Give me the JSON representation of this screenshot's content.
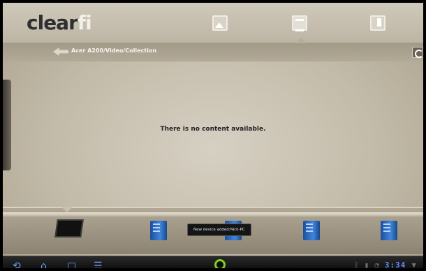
{
  "app": {
    "logo_text_left": "clear",
    "logo_text_right": "fi"
  },
  "tabs": [
    {
      "name": "photos",
      "icon": "photo-icon"
    },
    {
      "name": "videos",
      "icon": "video-icon",
      "selected": true
    },
    {
      "name": "music",
      "icon": "music-icon"
    }
  ],
  "breadcrumb": {
    "path": "Acer A200/Video/Collection"
  },
  "main": {
    "empty_message": "There is no content available."
  },
  "toast": {
    "message": "New device added:Nick-PC"
  },
  "status_bar": {
    "time": "3:34"
  },
  "colors": {
    "nav_icon": "#6ea7ff",
    "launcher_ring": "#7ed321"
  }
}
